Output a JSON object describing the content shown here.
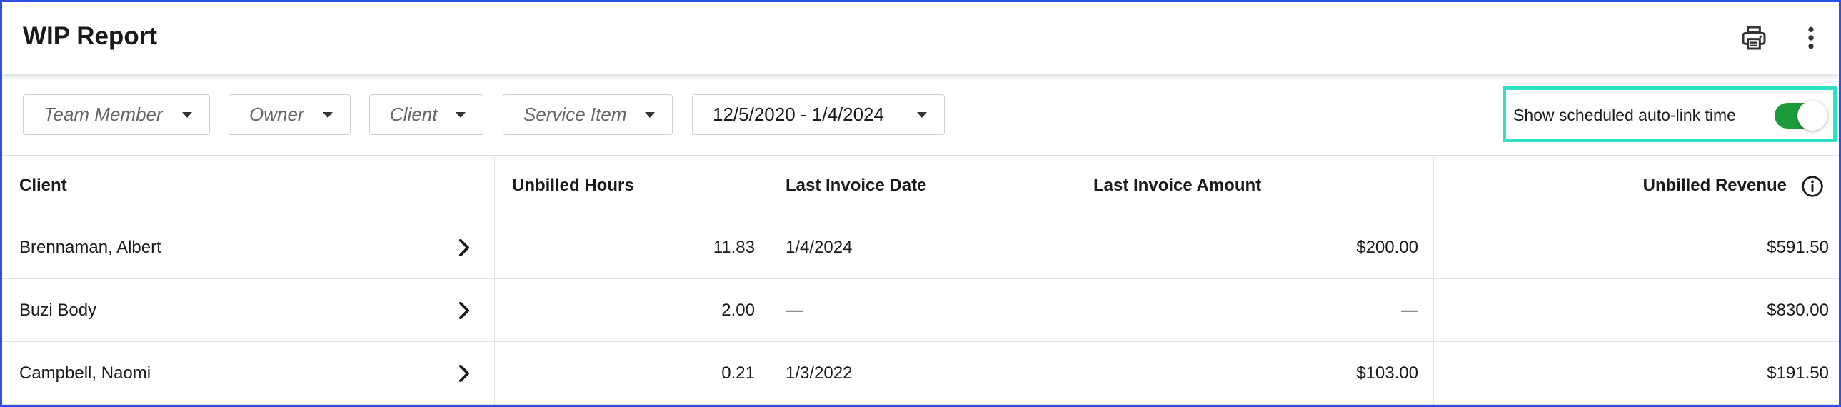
{
  "header": {
    "title": "WIP Report",
    "print_icon": "printer-icon",
    "more_icon": "more-vertical-icon"
  },
  "filters": {
    "team_member": "Team Member",
    "owner": "Owner",
    "client": "Client",
    "service_item": "Service Item",
    "date_range": "12/5/2020 - 1/4/2024"
  },
  "toggle": {
    "label": "Show scheduled auto-link time",
    "on": true,
    "color": "#1a9a3a",
    "highlight_color": "#2ee0c8"
  },
  "table": {
    "columns": {
      "client": "Client",
      "unbilled_hours": "Unbilled Hours",
      "last_invoice_date": "Last Invoice Date",
      "last_invoice_amount": "Last Invoice Amount",
      "unbilled_revenue": "Unbilled Revenue"
    },
    "rows": [
      {
        "client": "Brennaman, Albert",
        "unbilled_hours": "11.83",
        "last_invoice_date": "1/4/2024",
        "last_invoice_amount": "$200.00",
        "unbilled_revenue": "$591.50"
      },
      {
        "client": "Buzi Body",
        "unbilled_hours": "2.00",
        "last_invoice_date": "—",
        "last_invoice_amount": "—",
        "unbilled_revenue": "$830.00"
      },
      {
        "client": "Campbell, Naomi",
        "unbilled_hours": "0.21",
        "last_invoice_date": "1/3/2022",
        "last_invoice_amount": "$103.00",
        "unbilled_revenue": "$191.50"
      }
    ]
  },
  "colors": {
    "frame_border": "#2f4fe0"
  }
}
